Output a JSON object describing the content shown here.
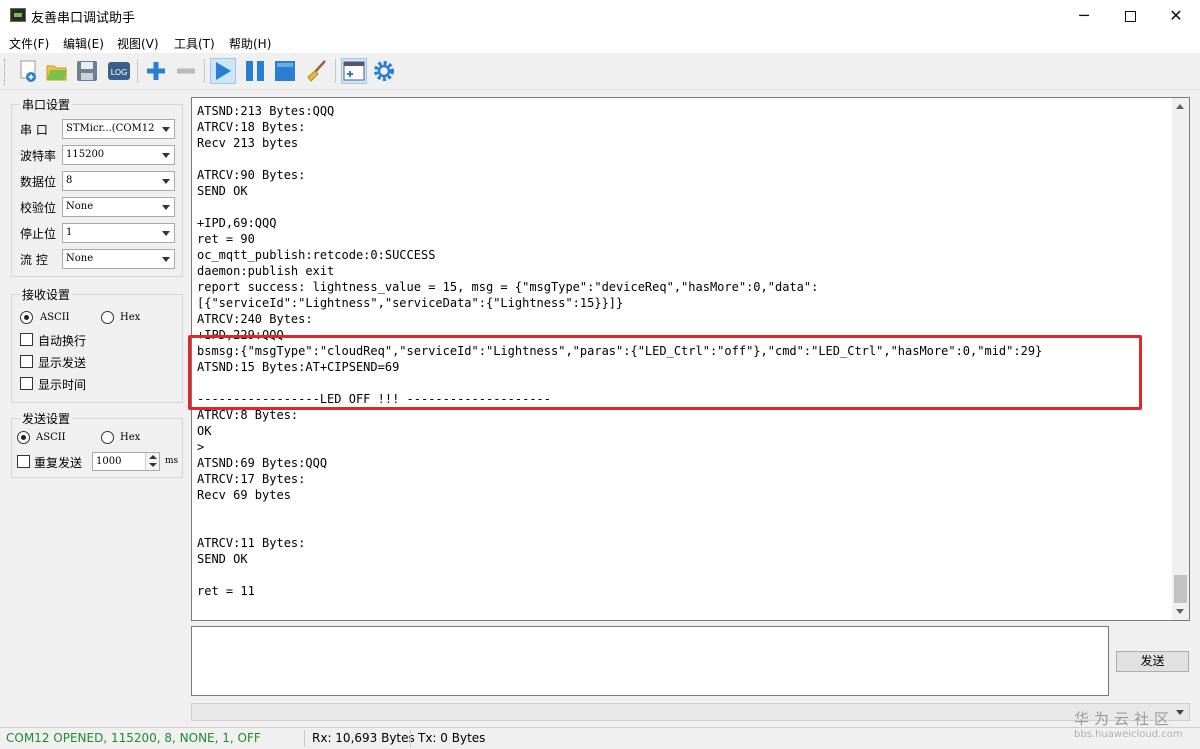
{
  "window": {
    "title": "友善串口调试助手",
    "minimize": "─",
    "close": "✕"
  },
  "menu": [
    "文件(F)",
    "编辑(E)",
    "视图(V)",
    "工具(T)",
    "帮助(H)"
  ],
  "toolbar": {
    "icons": [
      "new-icon",
      "open-icon",
      "save-icon",
      "log-icon",
      "plus-icon",
      "minus-icon",
      "play-icon",
      "pause-icon",
      "stop-icon",
      "clear-brush-icon",
      "window-icon",
      "gear-icon"
    ],
    "log_label": "LOG",
    "active": "play-icon"
  },
  "serial_settings": {
    "title": "串口设置",
    "port_label": "串 口",
    "port_value": "STMicr...(COM12",
    "baud_label": "波特率",
    "baud_value": "115200",
    "databits_label": "数据位",
    "databits_value": "8",
    "parity_label": "校验位",
    "parity_value": "None",
    "stopbits_label": "停止位",
    "stopbits_value": "1",
    "flow_label": "流 控",
    "flow_value": "None"
  },
  "receive_settings": {
    "title": "接收设置",
    "ascii": "ASCII",
    "hex": "Hex",
    "selected": "ASCII",
    "auto_newline": "自动换行",
    "show_send": "显示发送",
    "show_time": "显示时间"
  },
  "send_settings": {
    "title": "发送设置",
    "ascii": "ASCII",
    "hex": "Hex",
    "selected": "ASCII",
    "repeat": "重复发送",
    "interval": "1000",
    "unit": "ms"
  },
  "receive_lines": [
    "ATSND:213 Bytes:QQQ",
    "ATRCV:18 Bytes:",
    "Recv 213 bytes",
    "",
    "ATRCV:90 Bytes:",
    "SEND OK",
    "",
    "+IPD,69:QQQ",
    "ret = 90",
    "oc_mqtt_publish:retcode:0:SUCCESS",
    "daemon:publish exit",
    "report success: lightness_value = 15, msg = {\"msgType\":\"deviceReq\",\"hasMore\":0,\"data\":",
    "[{\"serviceId\":\"Lightness\",\"serviceData\":{\"Lightness\":15}}]}",
    "ATRCV:240 Bytes:",
    "+IPD,229:QQQ",
    "bsmsg:{\"msgType\":\"cloudReq\",\"serviceId\":\"Lightness\",\"paras\":{\"LED_Ctrl\":\"off\"},\"cmd\":\"LED_Ctrl\",\"hasMore\":0,\"mid\":29}",
    "ATSND:15 Bytes:AT+CIPSEND=69",
    "",
    "-----------------LED OFF !!! --------------------",
    "ATRCV:8 Bytes:",
    "OK",
    ">",
    "ATSND:69 Bytes:QQQ",
    "ATRCV:17 Bytes:",
    "Recv 69 bytes",
    "",
    "",
    "ATRCV:11 Bytes:",
    "SEND OK",
    "",
    "ret = 11"
  ],
  "send_area": {
    "value": "",
    "send_button": "发送"
  },
  "status": {
    "connection": "COM12 OPENED, 115200, 8, NONE, 1, OFF",
    "rx": "Rx: 10,693 Bytes",
    "tx": "Tx: 0 Bytes",
    "connection_color": "#1e8a2e"
  },
  "watermark": {
    "main": "华为云社区",
    "sub": "bbs.huaweicloud.com"
  },
  "colors": {
    "highlight": "#e3262d",
    "accent": "#2a7fd4"
  }
}
